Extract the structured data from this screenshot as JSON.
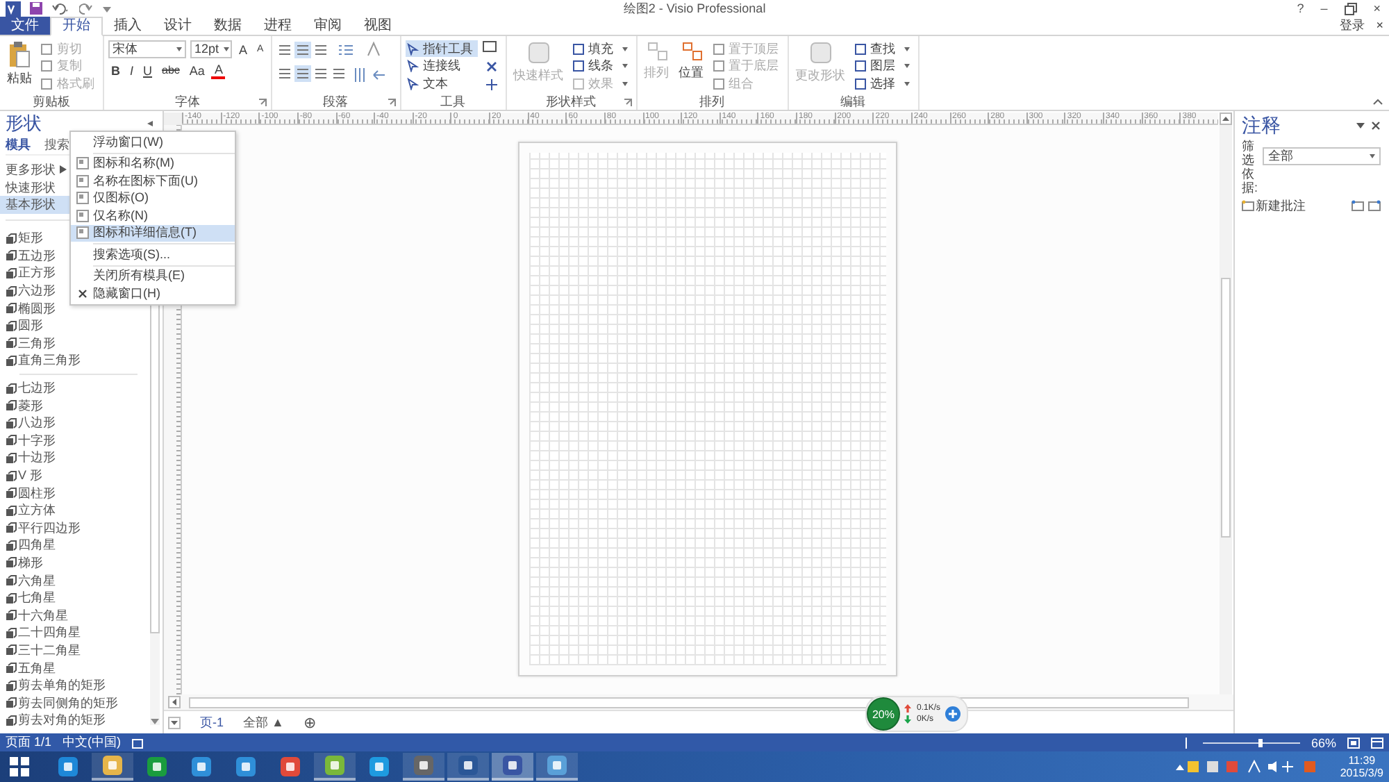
{
  "window": {
    "title": "绘图2 - Visio Professional",
    "help": "?",
    "minimize": "–",
    "close": "×",
    "sign_in": "登录",
    "ribbon_close": "×"
  },
  "tabs": [
    {
      "label": "文件",
      "kind": "file",
      "selected": false
    },
    {
      "label": "开始",
      "kind": "tab",
      "selected": true
    },
    {
      "label": "插入",
      "kind": "tab",
      "selected": false
    },
    {
      "label": "设计",
      "kind": "tab",
      "selected": false
    },
    {
      "label": "数据",
      "kind": "tab",
      "selected": false
    },
    {
      "label": "进程",
      "kind": "tab",
      "selected": false
    },
    {
      "label": "审阅",
      "kind": "tab",
      "selected": false
    },
    {
      "label": "视图",
      "kind": "tab",
      "selected": false
    }
  ],
  "ribbon": {
    "groups": [
      {
        "kind": "clipboard",
        "label": "剪贴板",
        "big": {
          "label": "粘贴",
          "disabled": false
        },
        "items": [
          {
            "label": "剪切",
            "disabled": true
          },
          {
            "label": "复制",
            "disabled": true
          },
          {
            "label": "格式刷",
            "disabled": true
          }
        ]
      },
      {
        "kind": "font",
        "label": "字体",
        "font": "宋体",
        "size": "12pt",
        "grow": "A",
        "shrink": "A",
        "formats": [
          "B",
          "I",
          "U",
          "abc",
          "Aa"
        ],
        "color_label": "A",
        "launcher": true
      },
      {
        "kind": "paragraph",
        "label": "段落",
        "launcher": true
      },
      {
        "kind": "tools",
        "label": "工具",
        "items": [
          {
            "label": "指针工具",
            "selected": true
          },
          {
            "label": "连接线",
            "selected": false
          },
          {
            "label": "文本",
            "selected": false
          }
        ]
      },
      {
        "kind": "style",
        "label": "形状样式",
        "big": {
          "label": "快速样式",
          "disabled": true
        },
        "items": [
          {
            "label": "填充",
            "disabled": false
          },
          {
            "label": "线条",
            "disabled": false
          },
          {
            "label": "效果",
            "disabled": true
          }
        ],
        "launcher": true
      },
      {
        "kind": "arrange",
        "label": "排列",
        "bigs": [
          {
            "label": "排列",
            "disabled": true
          },
          {
            "label": "位置",
            "disabled": false
          }
        ],
        "items": [
          {
            "label": "置于顶层",
            "disabled": true
          },
          {
            "label": "置于底层",
            "disabled": true
          },
          {
            "label": "组合",
            "disabled": true
          }
        ]
      },
      {
        "kind": "edit",
        "label": "编辑",
        "big": {
          "label": "更改形状",
          "disabled": true
        },
        "items": [
          {
            "label": "查找",
            "disabled": false
          },
          {
            "label": "图层",
            "disabled": false
          },
          {
            "label": "选择",
            "disabled": false
          }
        ]
      }
    ]
  },
  "shapes_panel": {
    "title": "形状",
    "tabs": [
      {
        "label": "模具",
        "selected": true
      },
      {
        "label": "搜索",
        "selected": false
      }
    ],
    "nav": [
      {
        "label": "更多形状",
        "submenu": true,
        "selected": false
      },
      {
        "label": "快速形状",
        "submenu": false,
        "selected": false
      },
      {
        "label": "基本形状",
        "submenu": false,
        "selected": true
      }
    ],
    "sections": [
      [
        "矩形",
        "五边形",
        "正方形",
        "六边形",
        "椭圆形",
        "圆形",
        "三角形",
        "直角三角形"
      ],
      [
        "七边形",
        "菱形",
        "八边形",
        "十字形",
        "十边形",
        "V 形",
        "圆柱形",
        "立方体",
        "平行四边形",
        "四角星",
        "梯形",
        "六角星",
        "七角星",
        "十六角星",
        "二十四角星",
        "三十二角星",
        "五角星",
        "剪去单角的矩形",
        "剪去同侧角的矩形",
        "剪去对角的矩形"
      ]
    ]
  },
  "context_menu": {
    "groups": [
      [
        {
          "label": "浮动窗口(W)",
          "kind": "plain",
          "selected": false
        }
      ],
      [
        {
          "label": "图标和名称(M)",
          "kind": "view",
          "selected": false
        },
        {
          "label": "名称在图标下面(U)",
          "kind": "view",
          "selected": false
        },
        {
          "label": "仅图标(O)",
          "kind": "view",
          "selected": false
        },
        {
          "label": "仅名称(N)",
          "kind": "view",
          "selected": false
        },
        {
          "label": "图标和详细信息(T)",
          "kind": "view",
          "selected": true
        }
      ],
      [
        {
          "label": "搜索选项(S)...",
          "kind": "plain",
          "selected": false
        }
      ],
      [
        {
          "label": "关闭所有模具(E)",
          "kind": "plain",
          "selected": false
        },
        {
          "label": "隐藏窗口(H)",
          "kind": "hide",
          "selected": false
        }
      ]
    ]
  },
  "ruler": {
    "labels": [
      "-140",
      "-120",
      "-100",
      "-80",
      "-60",
      "-40",
      "-20",
      "0",
      "20",
      "40",
      "60",
      "80",
      "100",
      "120",
      "140",
      "160",
      "180",
      "200",
      "220",
      "240",
      "260",
      "280",
      "300",
      "320",
      "340",
      "360",
      "380"
    ]
  },
  "page_tabs": [
    {
      "label": "页-1",
      "kind": "page",
      "selected": true
    },
    {
      "label": "全部 ▲",
      "kind": "all",
      "selected": false
    },
    {
      "label": "⊕",
      "kind": "add",
      "selected": false
    }
  ],
  "comments_panel": {
    "title": "注释",
    "filter_label": "筛选依据:",
    "filter_value": "全部",
    "new_comment": "新建批注"
  },
  "network_widget": {
    "percent": "20%",
    "upload": "0.1K/s",
    "download": "0K/s"
  },
  "status_bar": {
    "page": "页面 1/1",
    "language": "中文(中国)",
    "zoom": "66%"
  },
  "taskbar": {
    "apps": [
      {
        "open": false,
        "selected": false
      },
      {
        "open": true,
        "selected": false
      },
      {
        "open": false,
        "selected": false
      },
      {
        "open": false,
        "selected": false
      },
      {
        "open": false,
        "selected": false
      },
      {
        "open": false,
        "selected": false
      },
      {
        "open": true,
        "selected": false
      },
      {
        "open": false,
        "selected": false
      },
      {
        "open": true,
        "selected": false
      },
      {
        "open": true,
        "selected": false
      },
      {
        "open": true,
        "selected": true
      },
      {
        "open": true,
        "selected": false
      }
    ],
    "time": "11:39",
    "date": "2015/3/9"
  }
}
